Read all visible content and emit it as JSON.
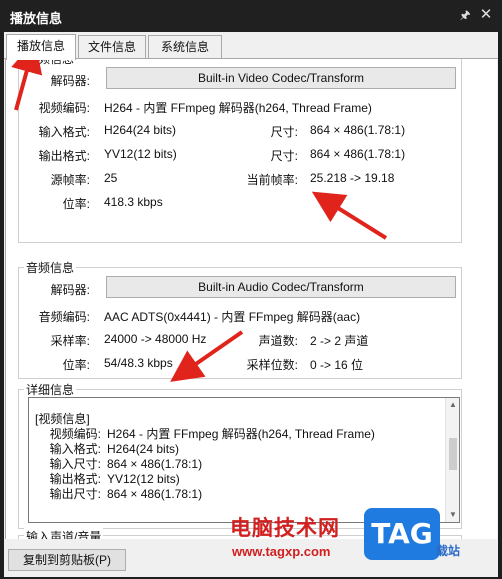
{
  "window": {
    "title": "播放信息",
    "pin_glyph": "🖈",
    "close_glyph": "✕"
  },
  "tabs": [
    {
      "label": "播放信息",
      "active": true
    },
    {
      "label": "文件信息",
      "active": false
    },
    {
      "label": "系统信息",
      "active": false
    }
  ],
  "video": {
    "group_title": "视频信息",
    "decoder_label": "解码器:",
    "decoder_button": "Built-in Video Codec/Transform",
    "codec_label": "视频编码:",
    "codec_value": "H264 - 内置 FFmpeg 解码器(h264, Thread Frame)",
    "input_format_label": "输入格式:",
    "input_format_value": "H264(24 bits)",
    "input_size_label": "尺寸:",
    "input_size_value": "864 × 486(1.78:1)",
    "output_format_label": "输出格式:",
    "output_format_value": "YV12(12 bits)",
    "output_size_label": "尺寸:",
    "output_size_value": "864 × 486(1.78:1)",
    "src_fps_label": "源帧率:",
    "src_fps_value": "25",
    "cur_fps_label": "当前帧率:",
    "cur_fps_value": "25.218 -> 19.18",
    "bitrate_label": "位率:",
    "bitrate_value": "418.3 kbps"
  },
  "audio": {
    "group_title": "音频信息",
    "decoder_label": "解码器:",
    "decoder_button": "Built-in Audio Codec/Transform",
    "codec_label": "音频编码:",
    "codec_value": "AAC ADTS(0x4441) - 内置 FFmpeg 解码器(aac)",
    "sample_rate_label": "采样率:",
    "sample_rate_value": "24000 -> 48000 Hz",
    "channels_label": "声道数:",
    "channels_value": "2 -> 2 声道",
    "bitrate_label": "位率:",
    "bitrate_value": "54/48.3 kbps",
    "sample_bits_label": "采样位数:",
    "sample_bits_value": "0 -> 16 位"
  },
  "details": {
    "group_title": "详细信息",
    "section_header": "[视频信息]",
    "lines": [
      {
        "key": "视频编码:",
        "value": "H264 - 内置 FFmpeg 解码器(h264, Thread Frame)"
      },
      {
        "key": "输入格式:",
        "value": "H264(24 bits)"
      },
      {
        "key": "输入尺寸:",
        "value": "864 × 486(1.78:1)"
      },
      {
        "key": "输出格式:",
        "value": "YV12(12 bits)"
      },
      {
        "key": "输出尺寸:",
        "value": "864 × 486(1.78:1)"
      }
    ]
  },
  "volume": {
    "group_title": "输入声道/音量"
  },
  "footer": {
    "copy_button": "复制到剪贴板(P)"
  },
  "watermark": {
    "site_name": "电脑技术网",
    "url": "www.tagxp.com",
    "tag": "TAG",
    "extra": "载站"
  },
  "colors": {
    "titlebar": "#202020",
    "annotation_arrow": "#e0241b",
    "watermark_red": "#d21f1f",
    "watermark_blue": "#1f7be0"
  }
}
